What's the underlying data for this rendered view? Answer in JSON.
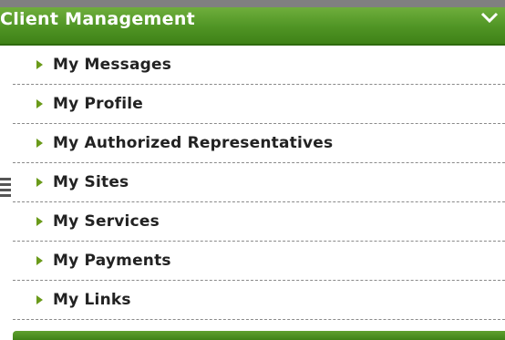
{
  "panel": {
    "title": "Client Management",
    "collapse_icon": "chevron-down-icon",
    "accent_color": "#4f9424"
  },
  "menu": {
    "items": [
      {
        "label": "My Messages"
      },
      {
        "label": "My Profile"
      },
      {
        "label": "My Authorized Representatives"
      },
      {
        "label": "My Sites"
      },
      {
        "label": "My Services"
      },
      {
        "label": "My Payments"
      },
      {
        "label": "My Links"
      }
    ],
    "bullet_icon": "triangle-right-icon",
    "bullet_color": "#6a9a1a"
  }
}
